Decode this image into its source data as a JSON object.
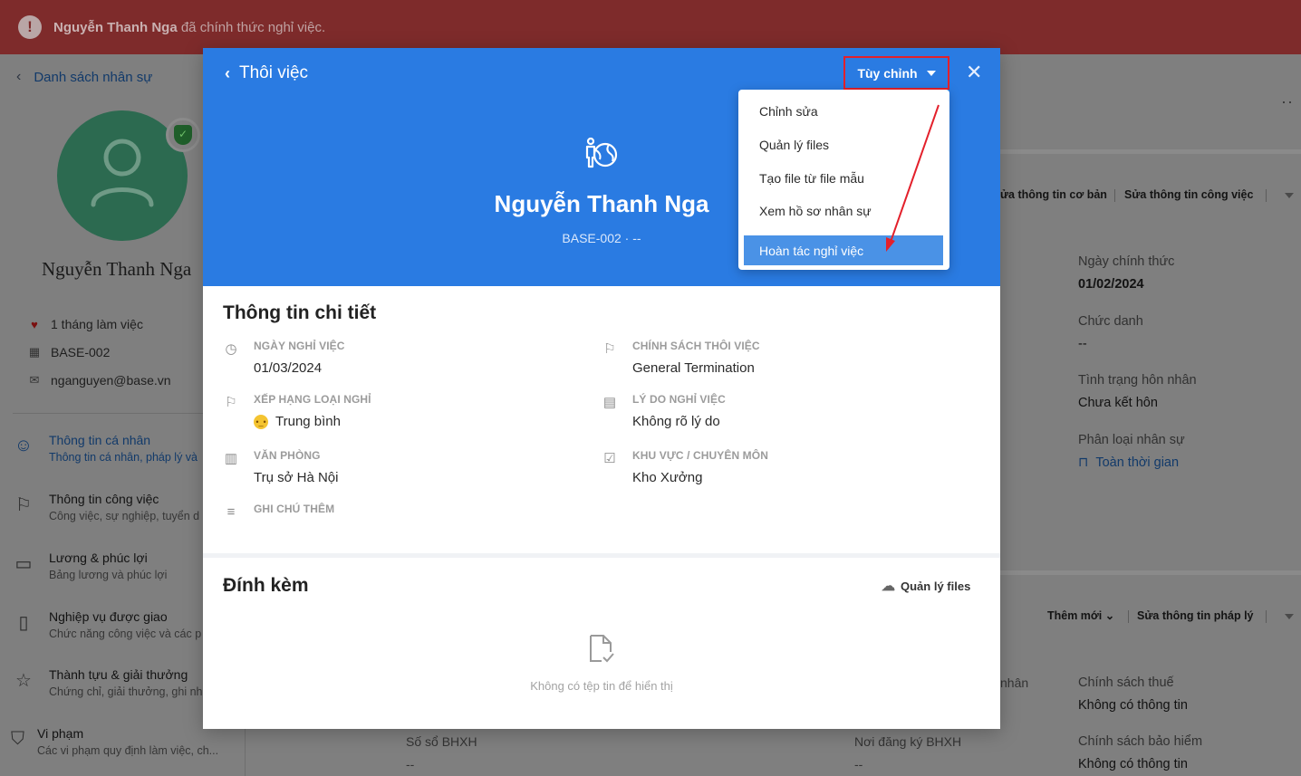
{
  "banner": {
    "name": "Nguyễn Thanh Nga",
    "text": "đã chính thức nghỉ việc."
  },
  "background": {
    "back_label": "Danh sách nhân sự",
    "employee_name": "Nguyễn Thanh Nga",
    "tenure": "1 tháng làm việc",
    "code": "BASE-002",
    "email": "nganguyen@base.vn",
    "nav": [
      {
        "title": "Thông tin cá nhân",
        "subtitle": "Thông tin cá nhân, pháp lý và"
      },
      {
        "title": "Thông tin công việc",
        "subtitle": "Công việc, sự nghiệp, tuyển d"
      },
      {
        "title": "Lương & phúc lợi",
        "subtitle": "Bảng lương và phúc lợi"
      },
      {
        "title": "Nghiệp vụ được giao",
        "subtitle": "Chức năng công việc và các p"
      },
      {
        "title": "Thành tựu & giải thưởng",
        "subtitle": "Chứng chỉ, giải thưởng, ghi nh"
      },
      {
        "title": "Vi phạm",
        "subtitle": "Các vi phạm quy định làm việc, ch..."
      }
    ],
    "actions_top": [
      "ửa thông tin cơ bản",
      "Sửa thông tin công việc"
    ],
    "actions_bottom": [
      "Thêm mới",
      "Sửa thông tin pháp lý"
    ],
    "right_fields": [
      {
        "label": "Ngày chính thức",
        "value": "01/02/2024"
      },
      {
        "label": "Chức danh",
        "value": "--"
      },
      {
        "label": "Tình trạng hôn nhân",
        "value": "Chưa kết hôn"
      },
      {
        "label": "Phân loại nhân sự",
        "value": "Toàn thời gian"
      }
    ],
    "bottom_fields": [
      {
        "label": "Chính sách thuế",
        "value": "Không có thông tin"
      },
      {
        "label": "Chính sách bảo hiểm",
        "value": "Không có thông tin"
      }
    ],
    "misc": {
      "partial_label": "nhân",
      "bhxh_no": "Số sổ BHXH",
      "bhxh_place": "Nơi đăng ký BHXH",
      "dash": "--"
    }
  },
  "modal": {
    "title": "Thôi việc",
    "customize_label": "Tùy chỉnh",
    "employee_name": "Nguyễn Thanh Nga",
    "employee_code": "BASE-002 · --",
    "dropdown": [
      "Chỉnh sửa",
      "Quản lý files",
      "Tạo file từ file mẫu",
      "Xem hồ sơ nhân sự",
      "Hoàn tác nghỉ việc"
    ],
    "details_title": "Thông tin chi tiết",
    "fields": {
      "leave_date": {
        "label": "NGÀY NGHỈ VIỆC",
        "value": "01/03/2024"
      },
      "policy": {
        "label": "CHÍNH SÁCH THÔI VIỆC",
        "value": "General Termination"
      },
      "rating": {
        "label": "XẾP HẠNG LOẠI NGHỈ",
        "value": "Trung bình"
      },
      "reason": {
        "label": "LÝ DO NGHỈ VIỆC",
        "value": "Không rõ lý do"
      },
      "office": {
        "label": "VĂN PHÒNG",
        "value": "Trụ sở Hà Nội"
      },
      "area": {
        "label": "KHU VỰC / CHUYÊN MÔN",
        "value": "Kho Xưởng"
      },
      "note": {
        "label": "GHI CHÚ THÊM",
        "value": ""
      }
    },
    "attach_title": "Đính kèm",
    "files_label": "Quản lý files",
    "empty_text": "Không có tệp tin để hiển thị"
  },
  "colors": {
    "banner": "#7e2b2b",
    "header_blue": "#2a7be2",
    "highlight": "#4a92e6",
    "annotation_red": "#e3202b"
  }
}
